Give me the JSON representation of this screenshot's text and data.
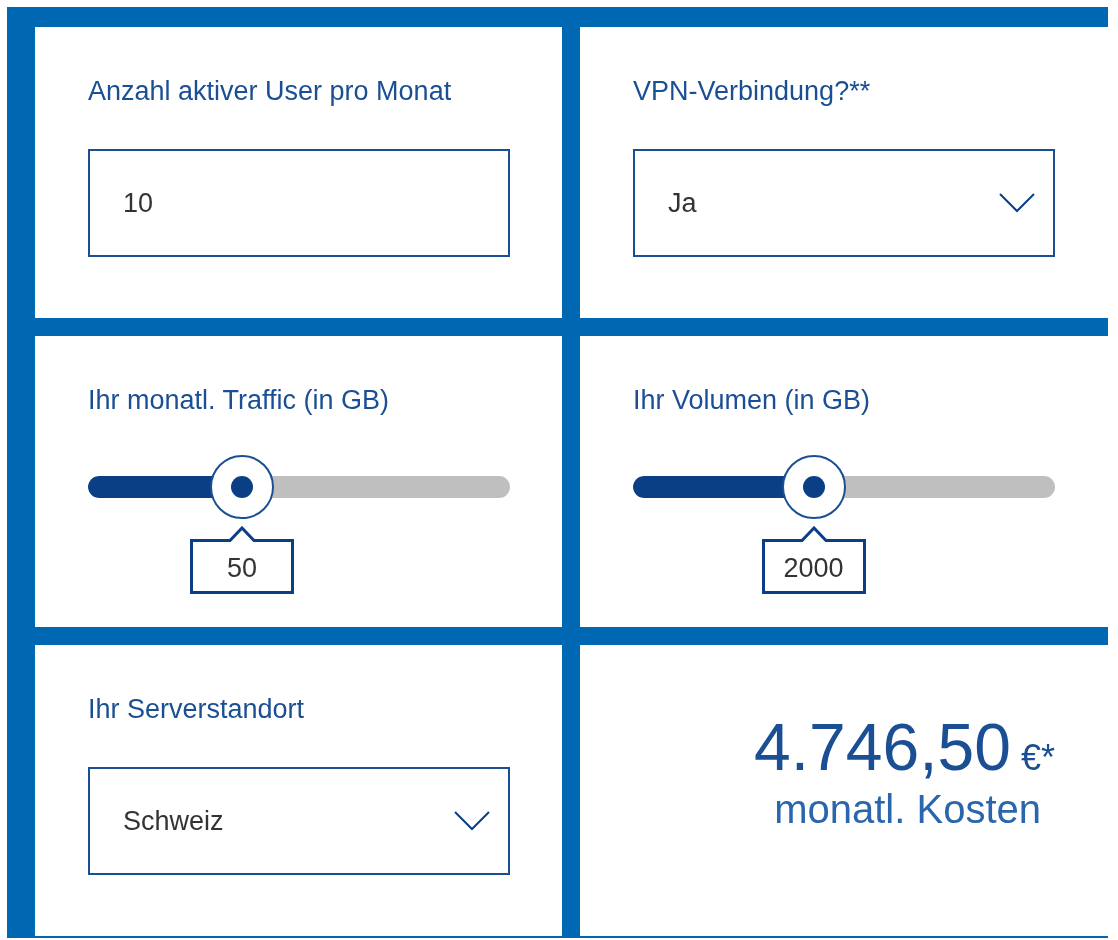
{
  "fields": [
    {
      "kind": "input",
      "label": "Anzahl aktiver User pro Monat",
      "value": "10"
    },
    {
      "kind": "select",
      "label": "VPN-Verbindung?**",
      "value": "Ja"
    },
    {
      "kind": "slider",
      "label": "Ihr monatl. Traffic (in GB)",
      "level": 0.365,
      "reading": "50"
    },
    {
      "kind": "slider",
      "label": "Ihr Volumen (in GB)",
      "level": 0.428,
      "reading": "2000"
    },
    {
      "kind": "select",
      "label": "Ihr Serverstandort",
      "value": "Schweiz"
    },
    {
      "kind": "cost",
      "amount": "4.746,50",
      "currency": "€*",
      "caption": "monatl. Kosten"
    }
  ]
}
